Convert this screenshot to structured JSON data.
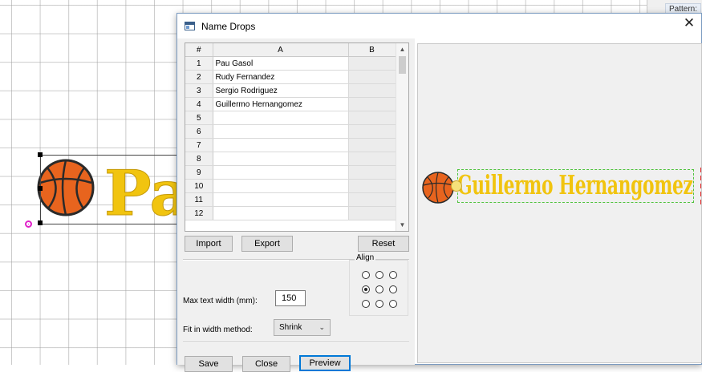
{
  "background": {
    "pattern_label": "Pattern:",
    "design_text": "Pa"
  },
  "dialog": {
    "title": "Name Drops",
    "close_glyph": "✕"
  },
  "grid": {
    "headers": {
      "num": "#",
      "a": "A",
      "b": "B"
    },
    "rows": [
      {
        "num": "1",
        "a": "Pau Gasol",
        "b": ""
      },
      {
        "num": "2",
        "a": "Rudy Fernandez",
        "b": ""
      },
      {
        "num": "3",
        "a": "Sergio Rodriguez",
        "b": ""
      },
      {
        "num": "4",
        "a": "Guillermo Hernangomez",
        "b": ""
      },
      {
        "num": "5",
        "a": "",
        "b": ""
      },
      {
        "num": "6",
        "a": "",
        "b": ""
      },
      {
        "num": "7",
        "a": "",
        "b": ""
      },
      {
        "num": "8",
        "a": "",
        "b": ""
      },
      {
        "num": "9",
        "a": "",
        "b": ""
      },
      {
        "num": "10",
        "a": "",
        "b": ""
      },
      {
        "num": "11",
        "a": "",
        "b": ""
      },
      {
        "num": "12",
        "a": "",
        "b": ""
      }
    ]
  },
  "buttons": {
    "import": "Import",
    "export": "Export",
    "reset": "Reset",
    "save": "Save",
    "close": "Close",
    "preview": "Preview"
  },
  "settings": {
    "max_text_width_label": "Max text width (mm):",
    "max_text_width_value": "150",
    "fit_method_label": "Fit in width method:",
    "fit_method_value": "Shrink",
    "align_label": "Align",
    "align_selected": "middle-left"
  },
  "preview": {
    "name_text": "Guillermo Hernangomez"
  },
  "colors": {
    "embroidery_yellow": "#f1c40f",
    "ball_orange": "#e8641e",
    "selection_green": "#4ec23c",
    "default_button_border": "#0078d7"
  }
}
